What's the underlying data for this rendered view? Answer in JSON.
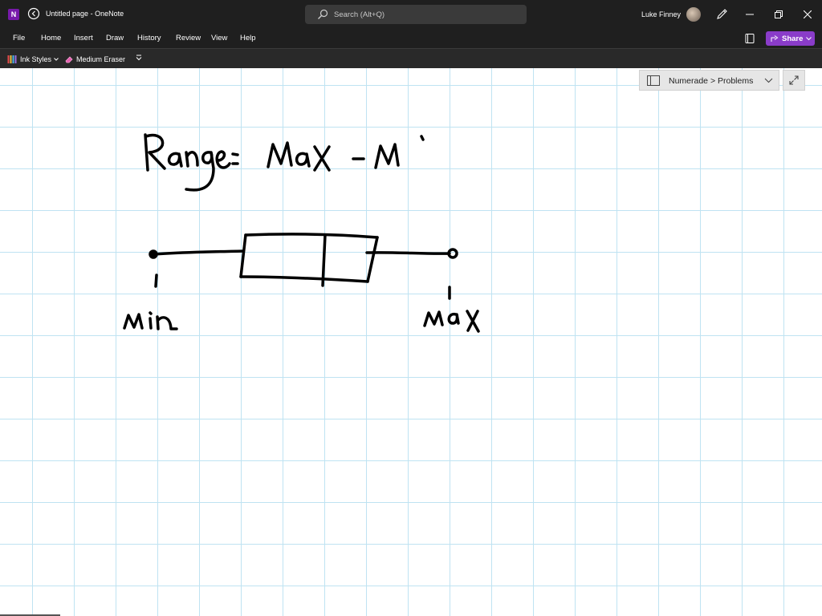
{
  "titlebar": {
    "app_letter": "N",
    "page_title": "Untitled page",
    "separator": "-",
    "app_name": "OneNote",
    "search_placeholder": "Search (Alt+Q)",
    "user_name": "Luke Finney"
  },
  "menu": {
    "items": [
      "File",
      "Home",
      "Insert",
      "Draw",
      "History",
      "Review",
      "View",
      "Help"
    ],
    "share_label": "Share"
  },
  "ribbon": {
    "ink_styles_label": "Ink Styles",
    "eraser_label": "Medium Eraser"
  },
  "breadcrumb": {
    "text": "Numerade > Problems"
  },
  "ink_text": {
    "range_formula": "Range = Max - M",
    "min_label": "Min",
    "max_label": "Max"
  },
  "colors": {
    "titlebar": "#1f1f1f",
    "ribbon": "#292929",
    "share": "#8a3cc9",
    "grid": "#bfe3f2",
    "ink": "#000000"
  },
  "icons": {
    "app": "onenote-icon",
    "back": "back-icon",
    "search": "search-icon",
    "pen": "pen-icon",
    "minimize": "minimize-icon",
    "restore": "restore-icon",
    "close": "close-icon",
    "notebook": "notebook-icon",
    "share": "share-icon",
    "ink_styles": "ink-styles-icon",
    "eraser": "eraser-icon",
    "more": "more-icon",
    "breadcrumb": "section-icon",
    "chevron": "chevron-down-icon",
    "expand": "expand-icon"
  }
}
